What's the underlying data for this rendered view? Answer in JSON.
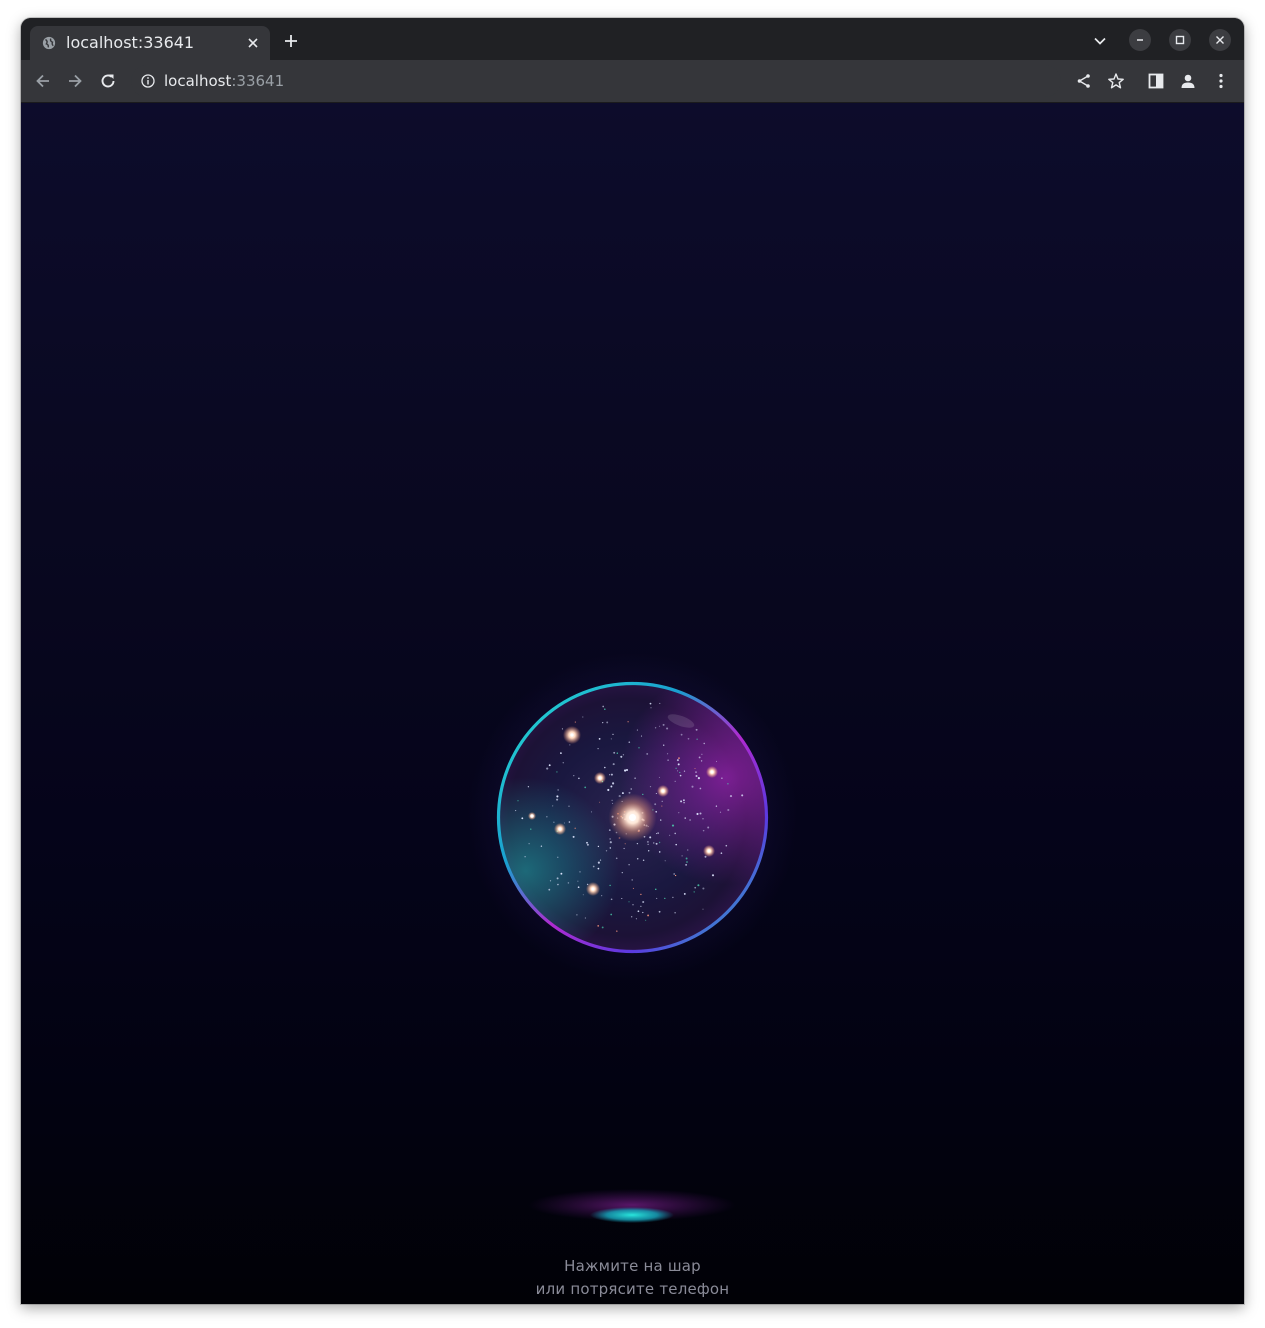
{
  "browser": {
    "tab_title": "localhost:33641",
    "url_host": "localhost",
    "url_port": ":33641",
    "icons": [
      "globe-icon",
      "close-icon",
      "plus-icon",
      "chevron-down-icon",
      "minimize-icon",
      "maximize-icon",
      "close-window-icon",
      "back-icon",
      "forward-icon",
      "reload-icon",
      "info-icon",
      "share-icon",
      "star-icon",
      "side-panel-icon",
      "profile-icon",
      "menu-icon"
    ]
  },
  "page": {
    "hint_line1": "Нажмите на шар",
    "hint_line2": "или потрясите телефон",
    "colors": {
      "background_top": "#0d0c2b",
      "background_bottom": "#010106",
      "orb_rim_teal": "#1fd6c8",
      "orb_rim_magenta": "#b02ad0",
      "hint_text": "#8a8b98"
    }
  }
}
